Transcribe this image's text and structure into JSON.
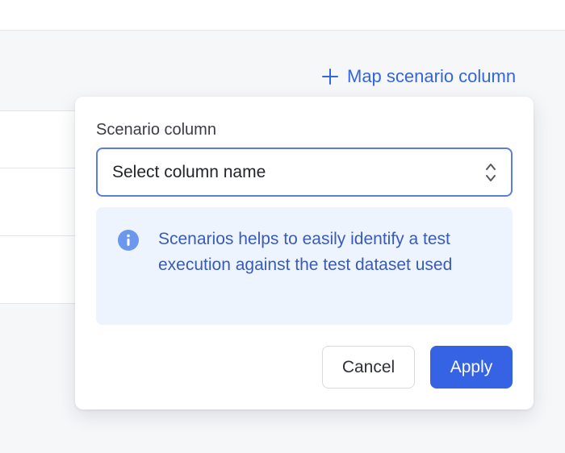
{
  "header": {
    "map_scenario_label": "Map scenario column",
    "map_scenario_icon": "plus-icon"
  },
  "popover": {
    "field_label": "Scenario column",
    "select": {
      "value": "Select column name",
      "icon": "chevron-up-down-icon"
    },
    "info": {
      "icon": "info-icon",
      "text": "Scenarios helps to easily identify a test execution against the test dataset used"
    },
    "buttons": {
      "cancel_label": "Cancel",
      "apply_label": "Apply"
    }
  },
  "colors": {
    "accent": "#3563e4",
    "link": "#3366dd",
    "info_bg": "#eef4fe",
    "info_text": "#3a5ab8",
    "info_icon": "#6b97ec"
  }
}
